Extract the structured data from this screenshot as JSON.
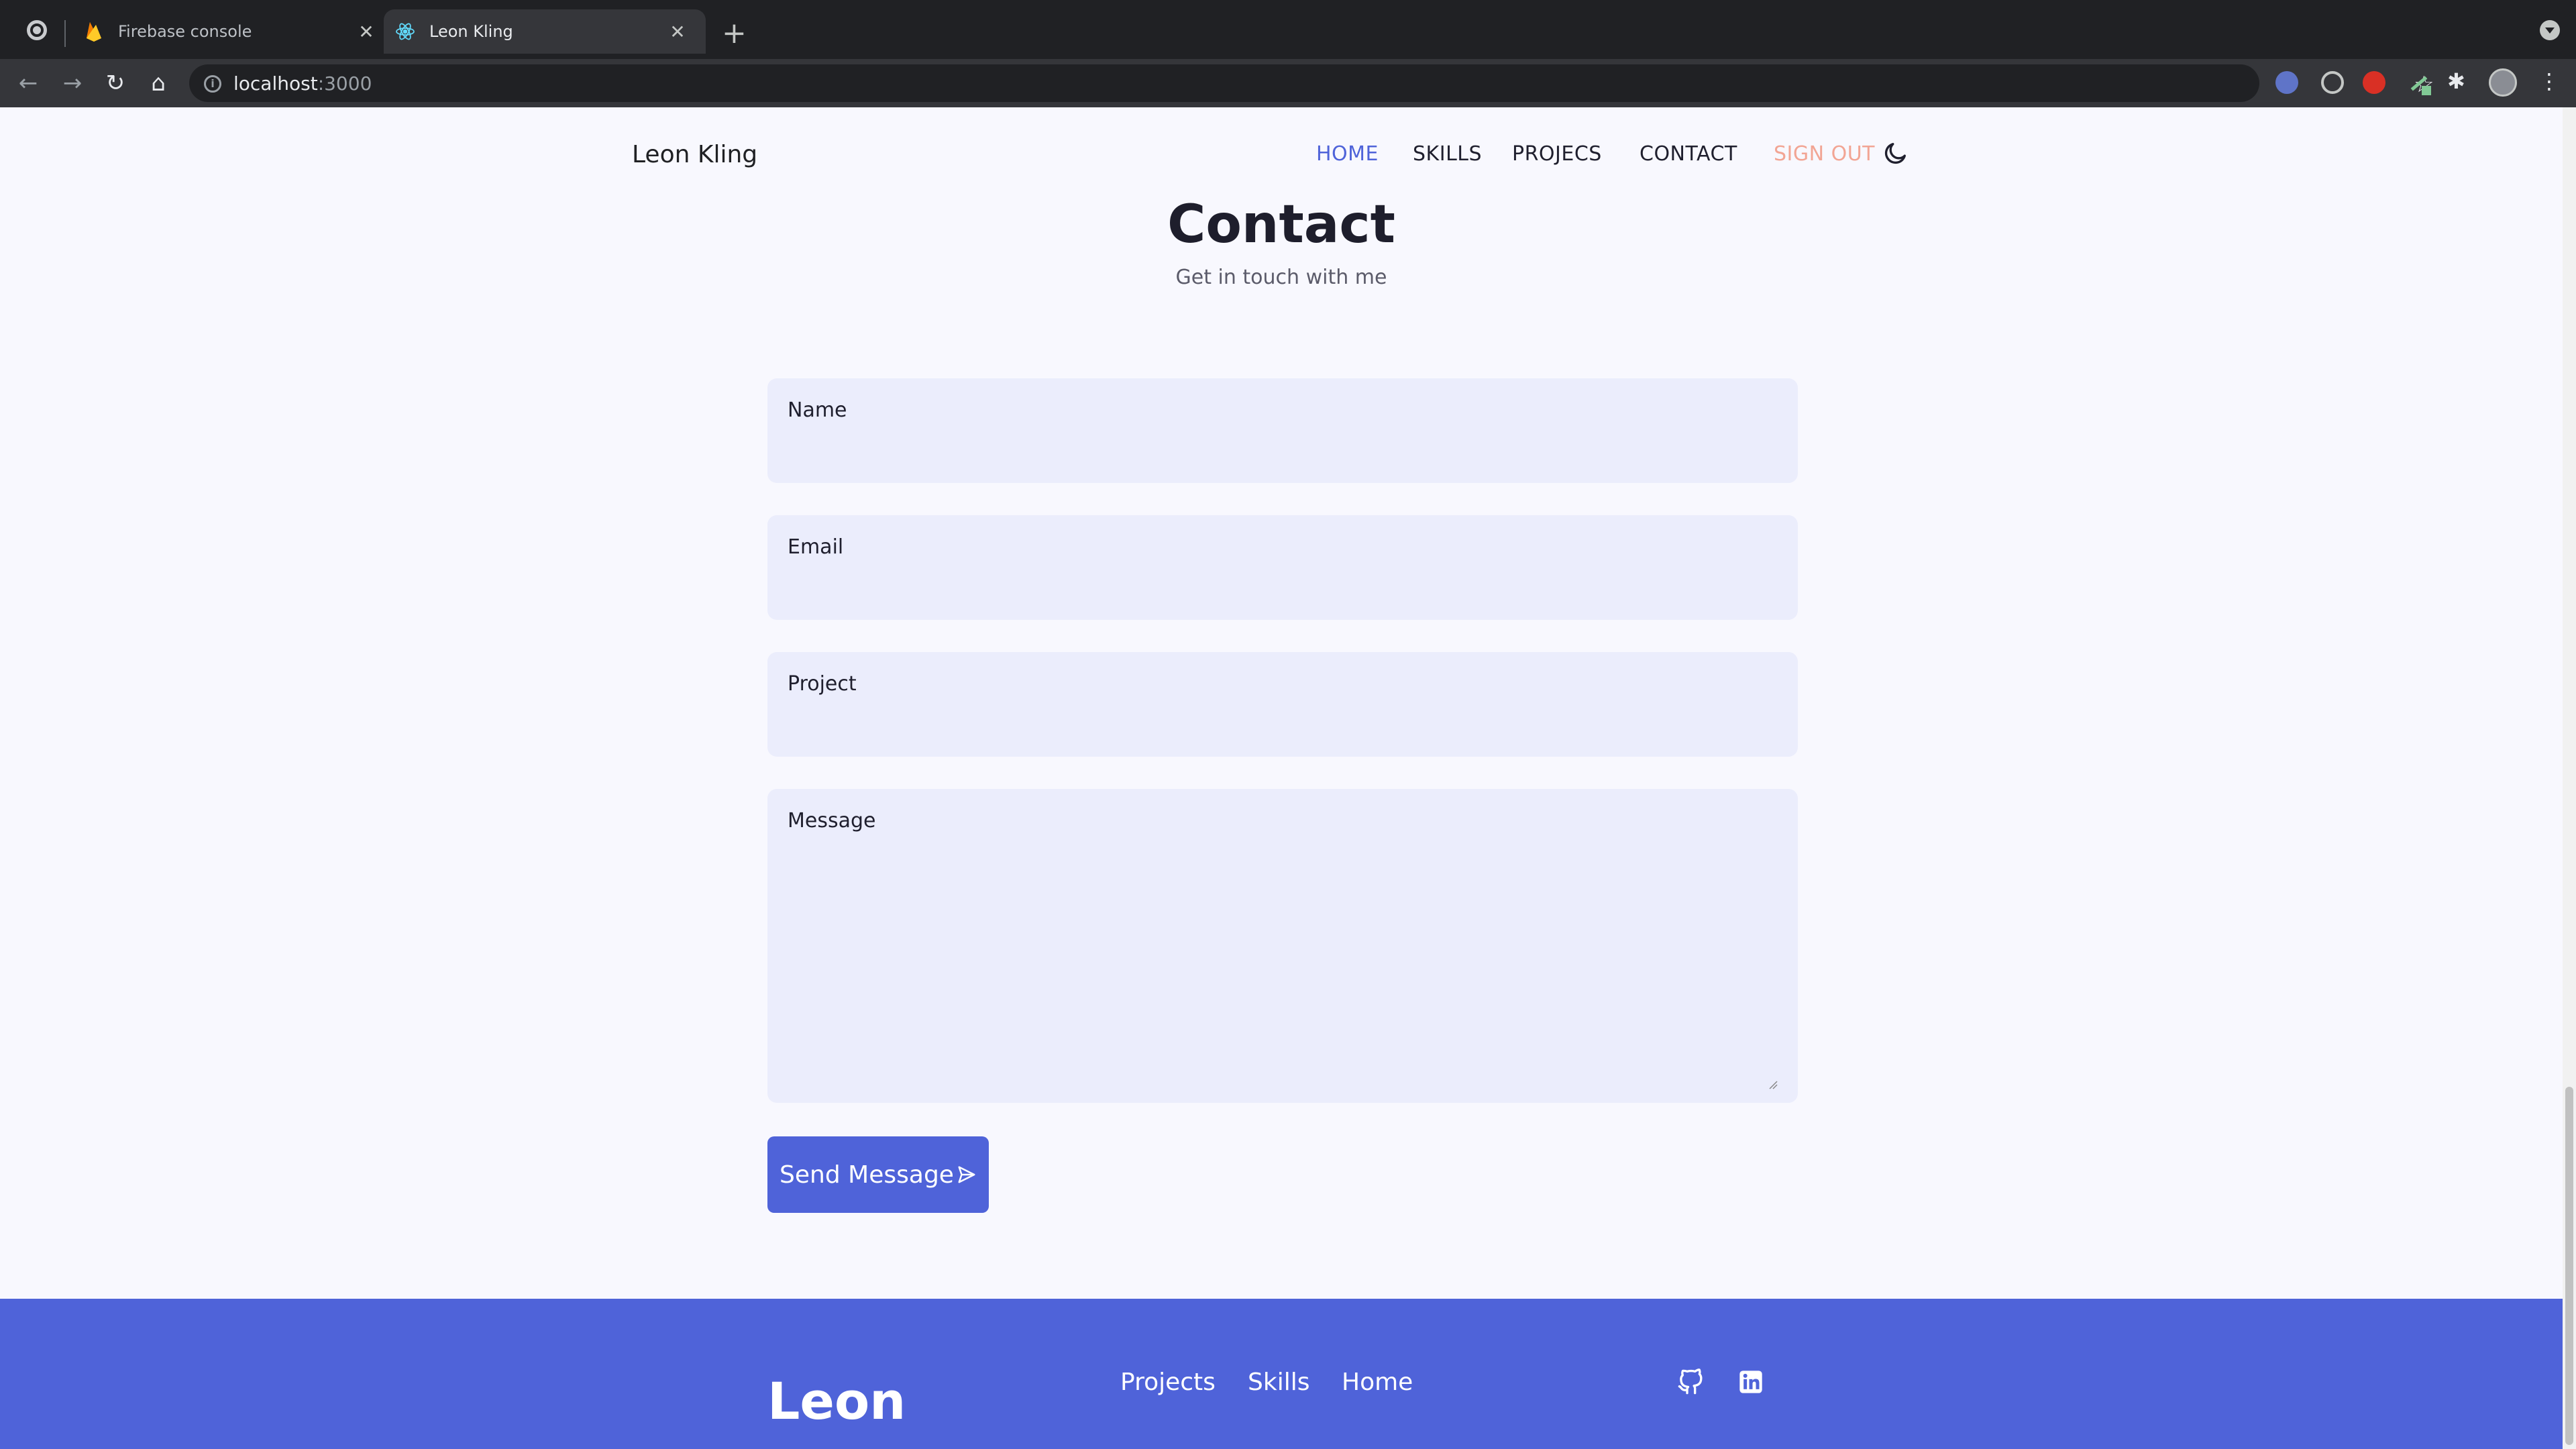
{
  "browser": {
    "tabs": [
      {
        "title": "Firebase console",
        "favicon": "firebase-icon"
      },
      {
        "title": "Leon Kling",
        "favicon": "react-icon",
        "active": true
      }
    ],
    "new_tab_symbol": "+",
    "close_symbol": "✕",
    "url_host": "localhost",
    "url_port": ":3000"
  },
  "header": {
    "logo": "Leon Kling",
    "nav": [
      "HOME",
      "SKILLS",
      "PROJECS",
      "CONTACT",
      "SIGN OUT"
    ],
    "active_nav": "HOME",
    "theme_toggle_icon": "moon-icon"
  },
  "contact": {
    "title": "Contact",
    "subtitle": "Get in touch with me",
    "fields": {
      "name": "Name",
      "email": "Email",
      "project": "Project",
      "message": "Message"
    },
    "send_label": "Send Message",
    "send_icon": "send-icon"
  },
  "footer": {
    "title": "Leon",
    "links": [
      "Projects",
      "Skills",
      "Home"
    ],
    "social_icons": [
      "github-icon",
      "linkedin-icon"
    ]
  },
  "colors": {
    "accent": "#4f63d9",
    "signout": "#f2a594",
    "field_bg": "#ebedfc",
    "page_bg": "#f8f8fe"
  }
}
